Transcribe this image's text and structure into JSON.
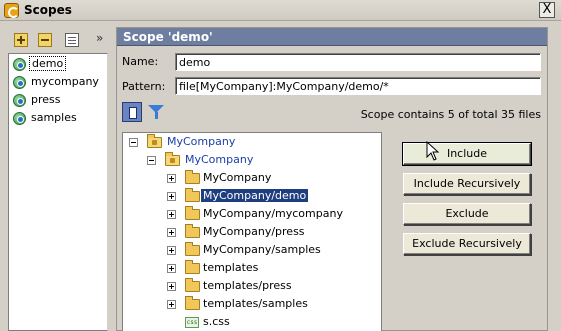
{
  "window": {
    "title": "Scopes",
    "close_glyph": "X"
  },
  "left_toolbar": {
    "add_icon": "add-icon",
    "remove_icon": "remove-icon",
    "copy_icon": "copy-icon",
    "more_glyph": "»"
  },
  "scopes": [
    {
      "label": "demo",
      "selected": true
    },
    {
      "label": "mycompany",
      "selected": false
    },
    {
      "label": "press",
      "selected": false
    },
    {
      "label": "samples",
      "selected": false
    }
  ],
  "panel": {
    "title": "Scope 'demo'",
    "name_label": "Name:",
    "name_value": "demo",
    "pattern_label": "Pattern:",
    "pattern_value": "file[MyCompany]:MyCompany/demo/*",
    "scope_info": "Scope contains 5 of total 35 files"
  },
  "tree": [
    {
      "label": "MyCompany",
      "type": "module",
      "expander": "minus",
      "blue": true
    },
    {
      "label": "MyCompany",
      "type": "package",
      "expander": "minus",
      "blue": true
    },
    {
      "label": "MyCompany",
      "type": "folder",
      "expander": "plus"
    },
    {
      "label": "MyCompany/demo",
      "type": "folder",
      "expander": "plus",
      "selected": true
    },
    {
      "label": "MyCompany/mycompany",
      "type": "folder",
      "expander": "plus"
    },
    {
      "label": "MyCompany/press",
      "type": "folder",
      "expander": "plus"
    },
    {
      "label": "MyCompany/samples",
      "type": "folder",
      "expander": "plus"
    },
    {
      "label": "templates",
      "type": "folder",
      "expander": "plus"
    },
    {
      "label": "templates/press",
      "type": "folder",
      "expander": "plus"
    },
    {
      "label": "templates/samples",
      "type": "folder",
      "expander": "plus"
    },
    {
      "label": "s.css",
      "type": "css",
      "expander": "none",
      "icon_text": "css"
    }
  ],
  "buttons": {
    "include": "Include",
    "include_recursively": "Include Recursively",
    "exclude": "Exclude",
    "exclude_recursively": "Exclude Recursively"
  },
  "colors": {
    "panel_header": "#6e7ea1",
    "selection": "#1e3e80",
    "link_blue": "#1a3ea8"
  }
}
